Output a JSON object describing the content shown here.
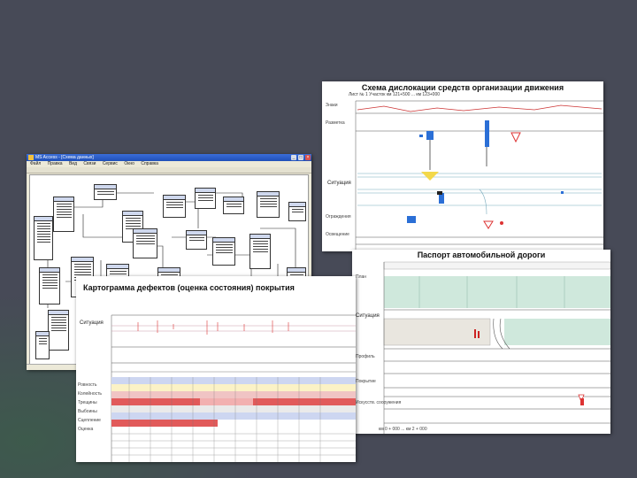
{
  "slide": {
    "background": "#474a57"
  },
  "db_window": {
    "title": "MS Access - [Схема данных]",
    "menu": [
      "Файл",
      "Правка",
      "Вид",
      "Связи",
      "Сервис",
      "Окно",
      "Справка"
    ],
    "minimize_glyph": "_",
    "maximize_glyph": "□",
    "close_glyph": "×"
  },
  "scheme": {
    "title": "Схема дислокации средств организации движения",
    "subtitle": "Лист № 1   Участок км 121+500 ... км 123+000",
    "situation_label": "Ситуация",
    "row_labels": [
      "Знаки",
      "Разметка",
      "Ограждения",
      "Освещение"
    ]
  },
  "passport": {
    "title": "Паспорт автомобильной дороги",
    "row_labels": [
      "План",
      "Ситуация",
      "Профиль",
      "Покрытие",
      "Искусств. сооружения"
    ],
    "footer": "км 0 + 000 ... км 2 + 000"
  },
  "cartogram": {
    "title": "Картограмма дефектов (оценка состояния) покрытия",
    "situation_label": "Ситуация",
    "row_labels": [
      "Ровность",
      "Колейность",
      "Трещины",
      "Выбоины",
      "Сцепление",
      "Оценка"
    ]
  }
}
